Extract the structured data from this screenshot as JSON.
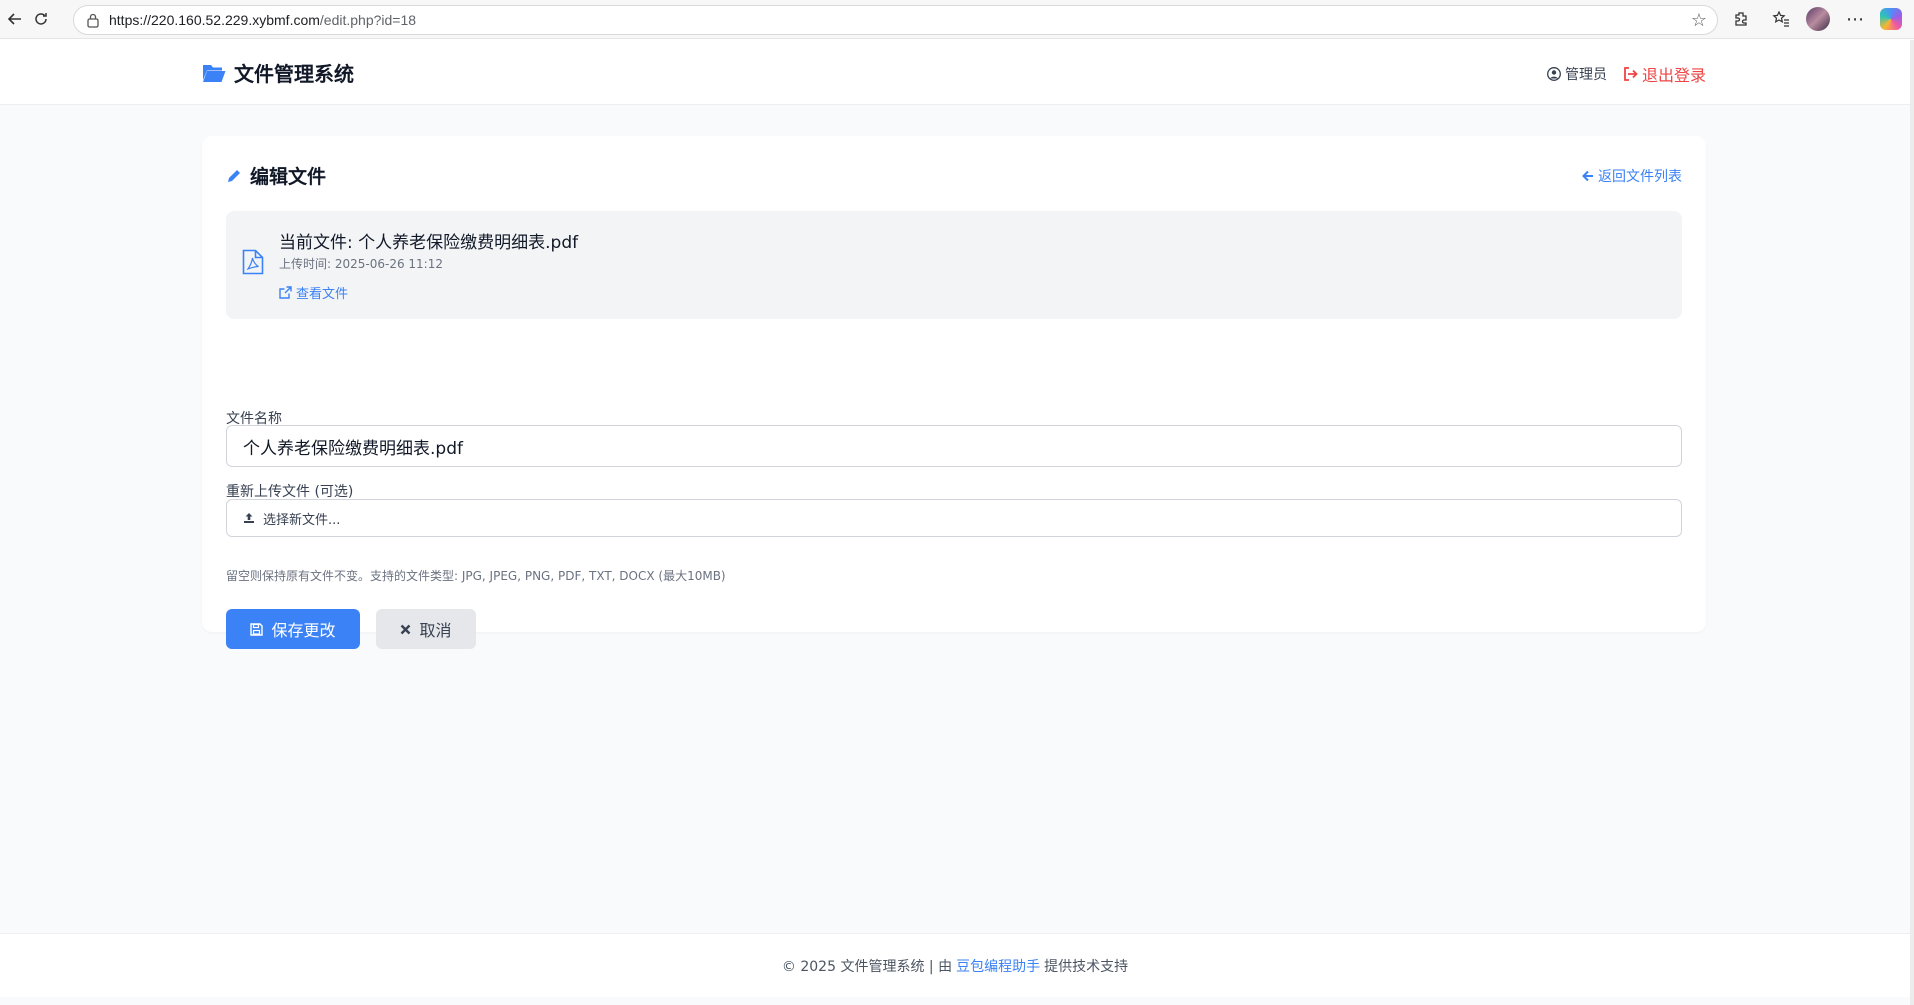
{
  "browser": {
    "url_host": "https://220.160.52.229.xybmf.com",
    "url_path": "/edit.php?id=18"
  },
  "header": {
    "brand": "文件管理系统",
    "user": "管理员",
    "logout": "退出登录"
  },
  "card": {
    "title": "编辑文件",
    "back_link": "返回文件列表",
    "current_file": {
      "name": "当前文件: 个人养老保险缴费明细表.pdf",
      "uploaded": "上传时间: 2025-06-26 11:12",
      "view_link": "查看文件"
    },
    "form": {
      "name_label": "文件名称",
      "name_value": "个人养老保险缴费明细表.pdf",
      "upload_label": "重新上传文件 (可选)",
      "upload_button": "选择新文件...",
      "hint": "留空则保持原有文件不变。支持的文件类型: JPG, JPEG, PNG, PDF, TXT, DOCX (最大10MB)",
      "save": "保存更改",
      "cancel": "取消"
    }
  },
  "footer": {
    "prefix": "© 2025 文件管理系统 | 由",
    "link": "豆包编程助手",
    "suffix": "提供技术支持"
  },
  "colors": {
    "primary": "#3b82f6",
    "danger": "#ef4444",
    "background": "#f9fafb"
  }
}
